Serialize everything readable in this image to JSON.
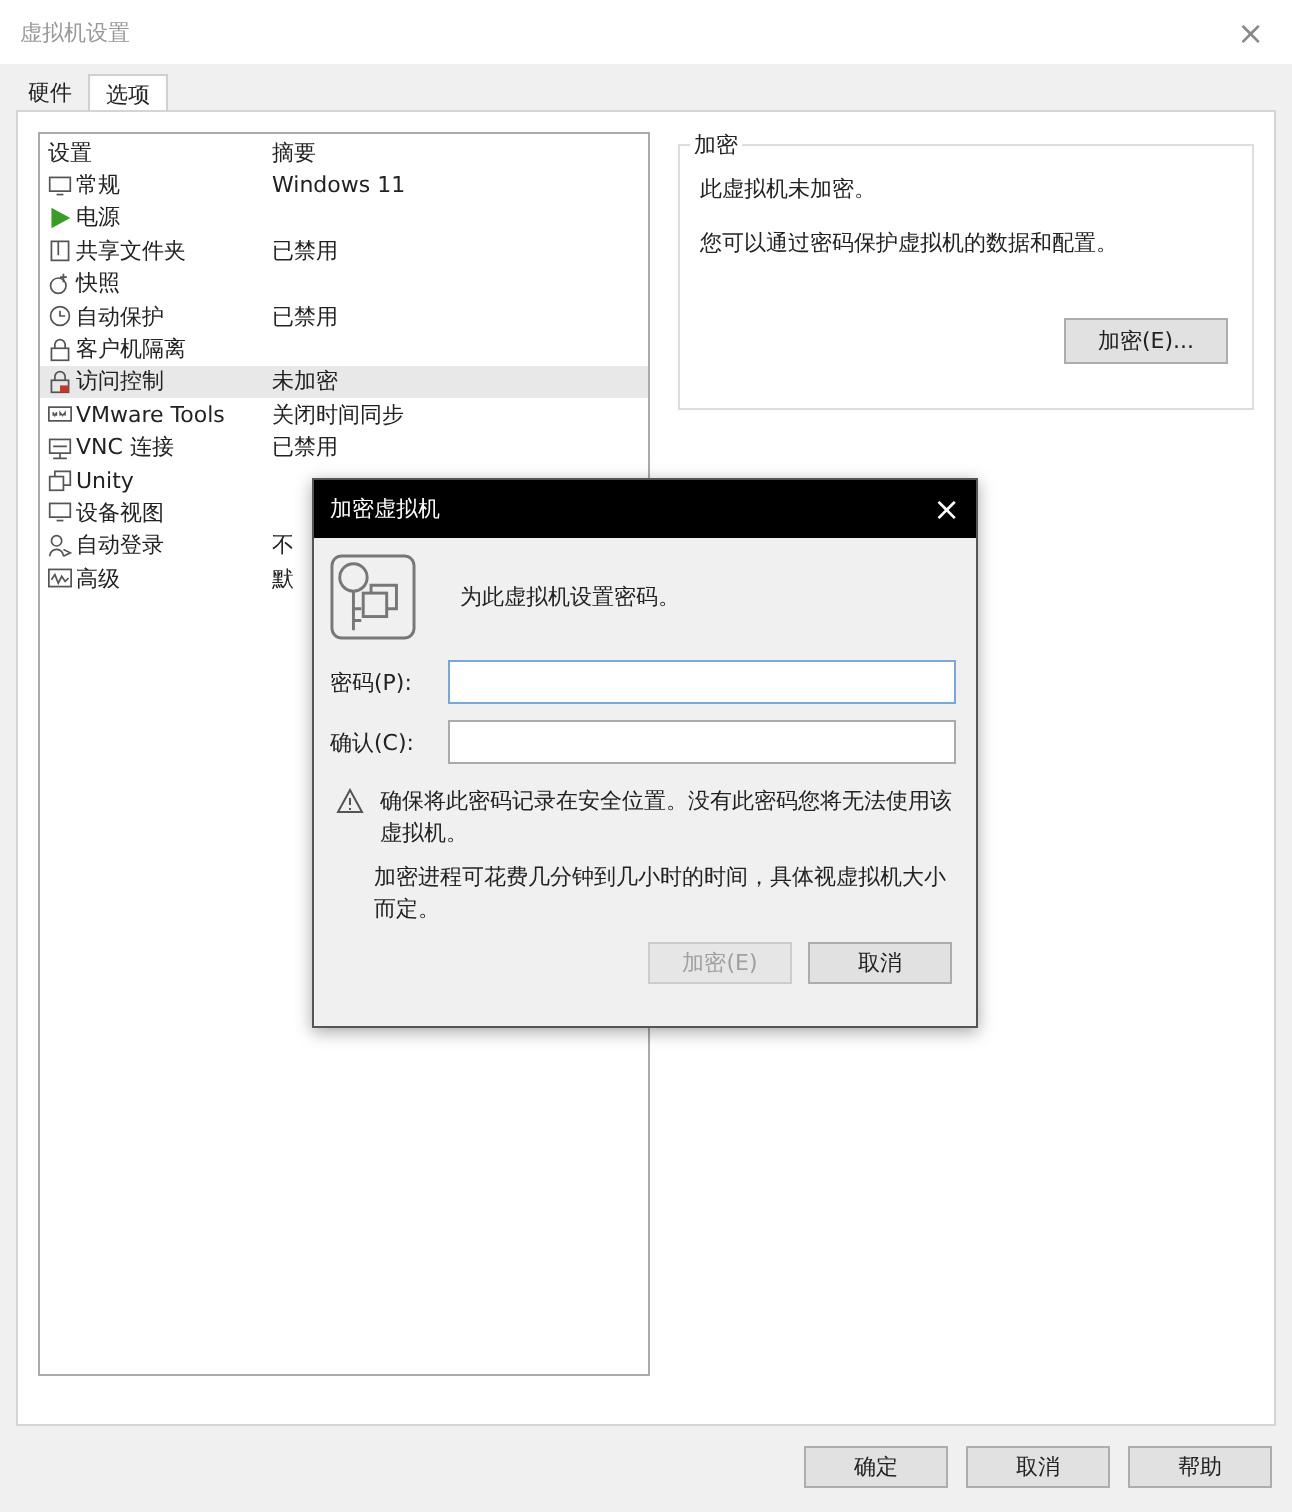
{
  "window": {
    "title": "虚拟机设置",
    "close": "×"
  },
  "tabs": [
    {
      "label": "硬件",
      "selected": false
    },
    {
      "label": "选项",
      "selected": true
    }
  ],
  "settings_list": {
    "columns": [
      "设置",
      "摘要"
    ],
    "rows": [
      {
        "name": "常规",
        "summary": "Windows 11",
        "selected": false
      },
      {
        "name": "电源",
        "summary": "",
        "selected": false
      },
      {
        "name": "共享文件夹",
        "summary": "已禁用",
        "selected": false
      },
      {
        "name": "快照",
        "summary": "",
        "selected": false
      },
      {
        "name": "自动保护",
        "summary": "已禁用",
        "selected": false
      },
      {
        "name": "客户机隔离",
        "summary": "",
        "selected": false
      },
      {
        "name": "访问控制",
        "summary": "未加密",
        "selected": true
      },
      {
        "name": "VMware Tools",
        "summary": "关闭时间同步",
        "selected": false
      },
      {
        "name": "VNC 连接",
        "summary": "已禁用",
        "selected": false
      },
      {
        "name": "Unity",
        "summary": "",
        "selected": false
      },
      {
        "name": "设备视图",
        "summary": "",
        "selected": false
      },
      {
        "name": "自动登录",
        "summary": "不",
        "selected": false
      },
      {
        "name": "高级",
        "summary": "默",
        "selected": false
      }
    ]
  },
  "encryption": {
    "legend": "加密",
    "status": "此虚拟机未加密。",
    "description": "您可以通过密码保护虚拟机的数据和配置。",
    "button": "加密(E)..."
  },
  "dialog": {
    "title": "加密虚拟机",
    "close": "×",
    "intro": "为此虚拟机设置密码。",
    "fields": [
      {
        "label": "密码(P):"
      },
      {
        "label": "确认(C):"
      }
    ],
    "warning": "确保将此密码记录在安全位置。没有此密码您将无法使用该虚拟机。",
    "note": "加密进程可花费几分钟到几小时的时间，具体视虚拟机大小而定。",
    "buttons": [
      {
        "label": "加密(E)",
        "disabled": true
      },
      {
        "label": "取消",
        "disabled": false
      }
    ]
  },
  "buttons": [
    "确定",
    "取消",
    "帮助"
  ]
}
